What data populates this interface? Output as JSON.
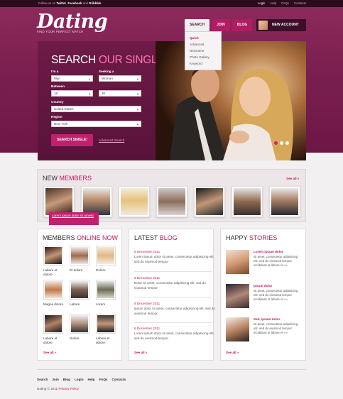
{
  "topbar": {
    "follow_prefix": "Follow us on",
    "twitter": "Twitter",
    "sep1": ",",
    "facebook": "Facebook",
    "and": "and",
    "dribbble": "Dribbble",
    "links": [
      "Login",
      "Help",
      "FAQs",
      "Contacts"
    ]
  },
  "header": {
    "logo": "Dating",
    "tagline": "FIND YOUR PERFECT MATCH",
    "nav": [
      "SEARCH",
      "JOIN",
      "BLOG"
    ],
    "new_account": "NEW ACCOUNT",
    "dropdown": [
      "Quick",
      "Advanced",
      "Nickname",
      "Photo Gallery",
      "Keyword"
    ]
  },
  "search": {
    "title_main": "SEARCH",
    "title_accent": "OUR SINGLES!",
    "im_label": "I'm a",
    "im_value": "Man",
    "seeking_label": "Seeking a",
    "seeking_value": "Woman",
    "between_label": "Between",
    "age_from": "18",
    "age_to": "30",
    "country_label": "Country",
    "country_value": "United States",
    "region_label": "Region",
    "region_value": "New York",
    "button": "SEARCH SINGLE!",
    "advanced_link": "Advanced Search"
  },
  "new_members": {
    "title_main": "NEW",
    "title_accent": "MEMBERS",
    "see_all": "See all »",
    "tooltip": "Lorem ipsum dolor sit amesit"
  },
  "online": {
    "title_main": "MEMBERS",
    "title_accent": "ONLINE NOW",
    "members": [
      {
        "name": "Labore et dolore"
      },
      {
        "name": "Et dolore"
      },
      {
        "name": "Dolore"
      },
      {
        "name": "Magna dolore"
      },
      {
        "name": "Labore"
      },
      {
        "name": "Lorem"
      },
      {
        "name": "Labore et dolore"
      },
      {
        "name": "Dolore"
      },
      {
        "name": "Labore et dolore"
      }
    ],
    "see_all": "See all »"
  },
  "blog": {
    "title_main": "LATEST",
    "title_accent": "BLOG",
    "posts": [
      {
        "date": "8 December 2011",
        "text": "Lorem ipsum dolor sit amet, consectetur adipisicing elit, sed do eiusmod tempor"
      },
      {
        "date": "8 December 2011",
        "text": "Dolor sit amet, consectetur adipisicing elit, sed do eiusmod tempor"
      },
      {
        "date": "8 December 2011",
        "text": "Ipsum dolor sit amet, consectetur adipisicing elit, sed do eiusmod tempor"
      },
      {
        "date": "8 December 2011",
        "text": "Lorem ipsum dolor sit amet, consectetur adipisicing elit, sed do eiusmod tempor"
      }
    ],
    "see_all": "See all »"
  },
  "stories": {
    "title_main": "HAPPY",
    "title_accent": "STORIES",
    "items": [
      {
        "title": "Lorem ipsum dolor",
        "text": "sit amet, consectetur adipisicing elit, sed do eiusmod tempor incididunt ut labore et"
      },
      {
        "title": "Ipsum dolor",
        "text": "sit amet, consectetur adipisicing elit, sed do eiusmod tempor incididunt ut labore et"
      },
      {
        "title": "Sed, ipsum dolor",
        "text": "sit amet, consectetur adipisicing elit, sed do eiusmod tempor incididunt ut labore et"
      }
    ],
    "more": "»»",
    "see_all": "See all »"
  },
  "footer": {
    "links": [
      "Search",
      "Join",
      "Blog",
      "Login",
      "Help",
      "FAQs",
      "Contacts"
    ],
    "copyright": "Dating © 2011",
    "privacy": "Privacy Policy"
  },
  "colors": {
    "accent": "#c2185b",
    "header_bg": "#7a1f4f",
    "topbar_bg": "#2e0a1d"
  }
}
